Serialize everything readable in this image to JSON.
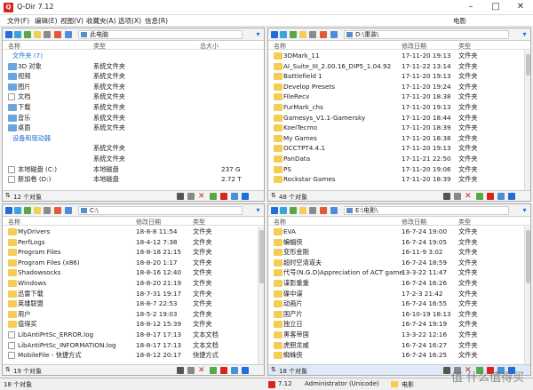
{
  "window": {
    "title": "Q-Dir 7.12",
    "app_icon": "Q"
  },
  "menu": [
    "文件(F)",
    "编辑(E)",
    "视图(V)",
    "收藏夹(A)",
    "选项(X)",
    "信息(R)",
    "电影"
  ],
  "panes": {
    "top_left": {
      "address": "此电脑",
      "columns": [
        "名称",
        "类型",
        "总大小"
      ],
      "groups": [
        {
          "label": "文件夹 (7)",
          "items": [
            {
              "name": "3D 对象",
              "type": "系统文件夹",
              "size": ""
            },
            {
              "name": "视频",
              "type": "系统文件夹",
              "size": ""
            },
            {
              "name": "图片",
              "type": "系统文件夹",
              "size": ""
            },
            {
              "name": "文档",
              "type": "系统文件夹",
              "size": ""
            },
            {
              "name": "下载",
              "type": "系统文件夹",
              "size": ""
            },
            {
              "name": "音乐",
              "type": "系统文件夹",
              "size": ""
            },
            {
              "name": "桌面",
              "type": "系统文件夹",
              "size": ""
            }
          ]
        },
        {
          "label": "设备和驱动器",
          "items": [
            {
              "name": "",
              "type": "系统文件夹",
              "size": ""
            },
            {
              "name": "",
              "type": "系统文件夹",
              "size": ""
            },
            {
              "name": "本地磁盘 (C:)",
              "type": "本地磁盘",
              "size": "237 G"
            },
            {
              "name": "新加卷 (D:)",
              "type": "本地磁盘",
              "size": "2.72 T"
            }
          ]
        }
      ],
      "status": "12 个对象"
    },
    "top_right": {
      "address": "D:\\重装\\",
      "columns": [
        "名称",
        "修改日期",
        "类型"
      ],
      "rows": [
        [
          "3DMark_11",
          "17-11-20 19:13",
          "文件夹"
        ],
        [
          "AI_Suite_III_2.00.16_DIP5_1.04.92",
          "17-11-22 13:14",
          "文件夹"
        ],
        [
          "Battlefield 1",
          "17-11-20 19:13",
          "文件夹"
        ],
        [
          "Develop Presets",
          "17-11-20 19:24",
          "文件夹"
        ],
        [
          "FileRecv",
          "17-11-20 18:38",
          "文件夹"
        ],
        [
          "FurMark_chs",
          "17-11-20 19:13",
          "文件夹"
        ],
        [
          "Gamesys_V1.1-Gamersky",
          "17-11-20 18:44",
          "文件夹"
        ],
        [
          "KoeiTecmo",
          "17-11-20 18:39",
          "文件夹"
        ],
        [
          "My Games",
          "17-11-20 18:38",
          "文件夹"
        ],
        [
          "OCCTPT4.4.1",
          "17-11-20 19:13",
          "文件夹"
        ],
        [
          "PanData",
          "17-11-21 22:50",
          "文件夹"
        ],
        [
          "PS",
          "17-11-20 19:06",
          "文件夹"
        ],
        [
          "Rockstar Games",
          "17-11-20 18:39",
          "文件夹"
        ]
      ],
      "status": "48 个对象"
    },
    "bottom_left": {
      "address": "C:\\",
      "columns": [
        "名称",
        "修改日期",
        "类型"
      ],
      "rows": [
        [
          "MyDrivers",
          "18-8-8 11:54",
          "文件夹"
        ],
        [
          "PerfLogs",
          "18-4-12 7:38",
          "文件夹"
        ],
        [
          "Program Files",
          "18-8-18 21:15",
          "文件夹"
        ],
        [
          "Program Files (x86)",
          "18-8-20 1:17",
          "文件夹"
        ],
        [
          "Shadowsocks",
          "18-8-16 12:40",
          "文件夹"
        ],
        [
          "Windows",
          "18-8-20 21:19",
          "文件夹"
        ],
        [
          "迅雷下载",
          "18-7-31 19:17",
          "文件夹"
        ],
        [
          "英雄联盟",
          "18-8-7 22:53",
          "文件夹"
        ],
        [
          "用户",
          "18-5-2 19:03",
          "文件夹"
        ],
        [
          "值得买",
          "18-8-12 15:39",
          "文件夹"
        ],
        [
          "LibAntiPrtSc_ERROR.log",
          "18-8-17 17:13",
          "文本文档"
        ],
        [
          "LibAntiPrtSc_INFORMATION.log",
          "18-8-17 17:13",
          "文本文档"
        ],
        [
          "MobileFile - 快捷方式",
          "18-8-12 20:17",
          "快捷方式"
        ]
      ],
      "status": "19 个对象"
    },
    "bottom_right": {
      "address": "E:\\电影\\",
      "columns": [
        "名称",
        "修改日期",
        "类型"
      ],
      "rows": [
        [
          "EVA",
          "16-7-24 19:00",
          "文件夹"
        ],
        [
          "蝙蝠侠",
          "16-7-24 19:05",
          "文件夹"
        ],
        [
          "变形金刚",
          "16-11-9 3:02",
          "文件夹"
        ],
        [
          "超时空清道夫",
          "16-7-24 18:59",
          "文件夹"
        ],
        [
          "代号(N.G.D)Appreciation of ACT game",
          "13-3-22 11:47",
          "文件夹"
        ],
        [
          "谍影重重",
          "16-7-24 16:26",
          "文件夹"
        ],
        [
          "碟中谍",
          "17-2-3 21:42",
          "文件夹"
        ],
        [
          "动画片",
          "16-7-24 16:55",
          "文件夹"
        ],
        [
          "国产片",
          "16-10-19 18:13",
          "文件夹"
        ],
        [
          "独立日",
          "16-7-24 19:19",
          "文件夹"
        ],
        [
          "黑客帝国",
          "13-3-22 12:16",
          "文件夹"
        ],
        [
          "虎胆龙威",
          "16-7-24 16:27",
          "文件夹"
        ],
        [
          "蜘蛛侠",
          "16-7-24 16:25",
          "文件夹"
        ]
      ],
      "status": "18 个对象"
    }
  },
  "bottom_bar": {
    "left": "18 个对象",
    "version": "7.12",
    "user": "Administrator (Unicode)",
    "folder": "电影",
    "watermark": "值 什么值得买"
  },
  "colors": {
    "accent": "#1e6fd9",
    "folder": "#f5cd55",
    "app_red": "#d9251c"
  }
}
